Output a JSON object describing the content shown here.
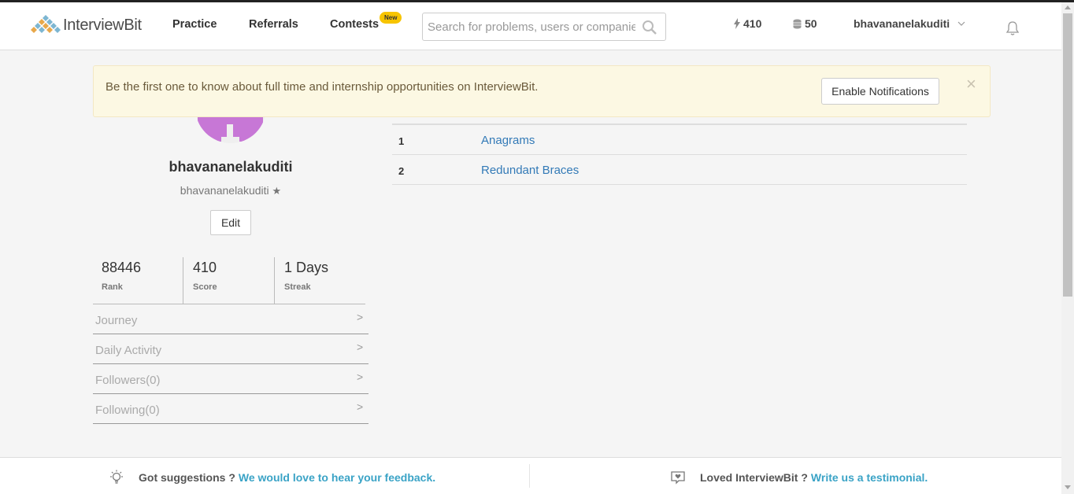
{
  "brand": {
    "name": "InterviewBit"
  },
  "nav": {
    "practice": "Practice",
    "referrals": "Referrals",
    "contests": "Contests",
    "contests_badge": "New"
  },
  "search": {
    "placeholder": "Search for problems, users or companies"
  },
  "topbar": {
    "score": "410",
    "coins": "50",
    "username": "bhavananelakuditi"
  },
  "alert": {
    "message": "Be the first one to know about full time and internship opportunities on InterviewBit.",
    "button": "Enable Notifications",
    "close": "×"
  },
  "profile": {
    "display_name": "bhavananelakuditi",
    "handle": "bhavananelakuditi",
    "edit_label": "Edit",
    "stats": [
      {
        "value": "88446",
        "label": "Rank"
      },
      {
        "value": "410",
        "label": "Score"
      },
      {
        "value": "1 Days",
        "label": "Streak"
      }
    ],
    "menu": [
      {
        "label": "Journey"
      },
      {
        "label": "Daily Activity"
      },
      {
        "label": "Followers(0)"
      },
      {
        "label": "Following(0)"
      }
    ]
  },
  "problems": [
    {
      "num": "1",
      "name": "Anagrams"
    },
    {
      "num": "2",
      "name": "Redundant Braces"
    }
  ],
  "footer": {
    "suggest_text": "Got suggestions ?",
    "suggest_link": "We would love to hear your feedback.",
    "loved_text": "Loved InterviewBit ?",
    "loved_link": "Write us a testimonial."
  },
  "colors": {
    "accent_link": "#337ab7",
    "footer_link": "#3aa3c6",
    "alert_bg": "#fcf8e3",
    "badge": "#f7c400",
    "avatar": "#c777d6"
  }
}
